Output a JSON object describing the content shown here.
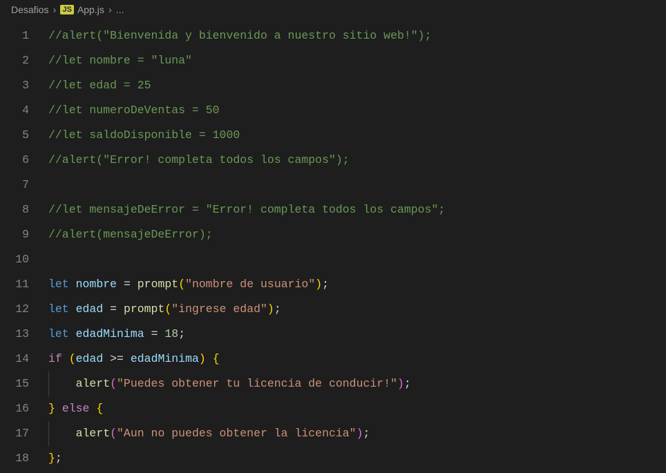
{
  "breadcrumb": {
    "folder": "Desafios",
    "file_badge": "JS",
    "file": "App.js",
    "symbol": "..."
  },
  "code": {
    "lines": [
      {
        "n": 1,
        "indent": 0,
        "tokens": [
          [
            "comment",
            "//alert(\"Bienvenida y bienvenido a nuestro sitio web!\");"
          ]
        ]
      },
      {
        "n": 2,
        "indent": 0,
        "tokens": [
          [
            "comment",
            "//let nombre = \"luna\""
          ]
        ]
      },
      {
        "n": 3,
        "indent": 0,
        "tokens": [
          [
            "comment",
            "//let edad = 25"
          ]
        ]
      },
      {
        "n": 4,
        "indent": 0,
        "tokens": [
          [
            "comment",
            "//let numeroDeVentas = 50"
          ]
        ]
      },
      {
        "n": 5,
        "indent": 0,
        "tokens": [
          [
            "comment",
            "//let saldoDisponible = 1000"
          ]
        ]
      },
      {
        "n": 6,
        "indent": 0,
        "tokens": [
          [
            "comment",
            "//alert(\"Error! completa todos los campos\");"
          ]
        ]
      },
      {
        "n": 7,
        "indent": 0,
        "tokens": []
      },
      {
        "n": 8,
        "indent": 0,
        "tokens": [
          [
            "comment",
            "//let mensajeDeError = \"Error! completa todos los campos\";"
          ]
        ]
      },
      {
        "n": 9,
        "indent": 0,
        "tokens": [
          [
            "comment",
            "//alert(mensajeDeError);"
          ]
        ]
      },
      {
        "n": 10,
        "indent": 0,
        "tokens": []
      },
      {
        "n": 11,
        "indent": 0,
        "tokens": [
          [
            "keyword",
            "let"
          ],
          [
            "operator",
            " "
          ],
          [
            "variable",
            "nombre"
          ],
          [
            "operator",
            " "
          ],
          [
            "operator",
            "="
          ],
          [
            "operator",
            " "
          ],
          [
            "function",
            "prompt"
          ],
          [
            "bracket-y",
            "("
          ],
          [
            "string",
            "\"nombre de usuario\""
          ],
          [
            "bracket-y",
            ")"
          ],
          [
            "punct",
            ";"
          ]
        ]
      },
      {
        "n": 12,
        "indent": 0,
        "tokens": [
          [
            "keyword",
            "let"
          ],
          [
            "operator",
            " "
          ],
          [
            "variable",
            "edad"
          ],
          [
            "operator",
            " "
          ],
          [
            "operator",
            "="
          ],
          [
            "operator",
            " "
          ],
          [
            "function",
            "prompt"
          ],
          [
            "bracket-y",
            "("
          ],
          [
            "string",
            "\"ingrese edad\""
          ],
          [
            "bracket-y",
            ")"
          ],
          [
            "punct",
            ";"
          ]
        ]
      },
      {
        "n": 13,
        "indent": 0,
        "tokens": [
          [
            "keyword",
            "let"
          ],
          [
            "operator",
            " "
          ],
          [
            "variable",
            "edadMinima"
          ],
          [
            "operator",
            " "
          ],
          [
            "operator",
            "="
          ],
          [
            "operator",
            " "
          ],
          [
            "number",
            "18"
          ],
          [
            "punct",
            ";"
          ]
        ]
      },
      {
        "n": 14,
        "indent": 0,
        "tokens": [
          [
            "control",
            "if"
          ],
          [
            "operator",
            " "
          ],
          [
            "bracket-y",
            "("
          ],
          [
            "variable",
            "edad"
          ],
          [
            "operator",
            " "
          ],
          [
            "operator",
            ">="
          ],
          [
            "operator",
            " "
          ],
          [
            "variable",
            "edadMinima"
          ],
          [
            "bracket-y",
            ")"
          ],
          [
            "operator",
            " "
          ],
          [
            "bracket-y",
            "{"
          ]
        ]
      },
      {
        "n": 15,
        "indent": 1,
        "tokens": [
          [
            "function",
            "alert"
          ],
          [
            "bracket-p",
            "("
          ],
          [
            "string",
            "\"Puedes obtener tu licencia de conducir!\""
          ],
          [
            "bracket-p",
            ")"
          ],
          [
            "punct",
            ";"
          ]
        ]
      },
      {
        "n": 16,
        "indent": 0,
        "tokens": [
          [
            "bracket-y",
            "}"
          ],
          [
            "operator",
            " "
          ],
          [
            "control",
            "else"
          ],
          [
            "operator",
            " "
          ],
          [
            "bracket-y",
            "{"
          ]
        ]
      },
      {
        "n": 17,
        "indent": 1,
        "tokens": [
          [
            "function",
            "alert"
          ],
          [
            "bracket-p",
            "("
          ],
          [
            "string",
            "\"Aun no puedes obtener la licencia\""
          ],
          [
            "bracket-p",
            ")"
          ],
          [
            "punct",
            ";"
          ]
        ]
      },
      {
        "n": 18,
        "indent": 0,
        "tokens": [
          [
            "bracket-y",
            "}"
          ],
          [
            "punct",
            ";"
          ]
        ]
      }
    ]
  }
}
